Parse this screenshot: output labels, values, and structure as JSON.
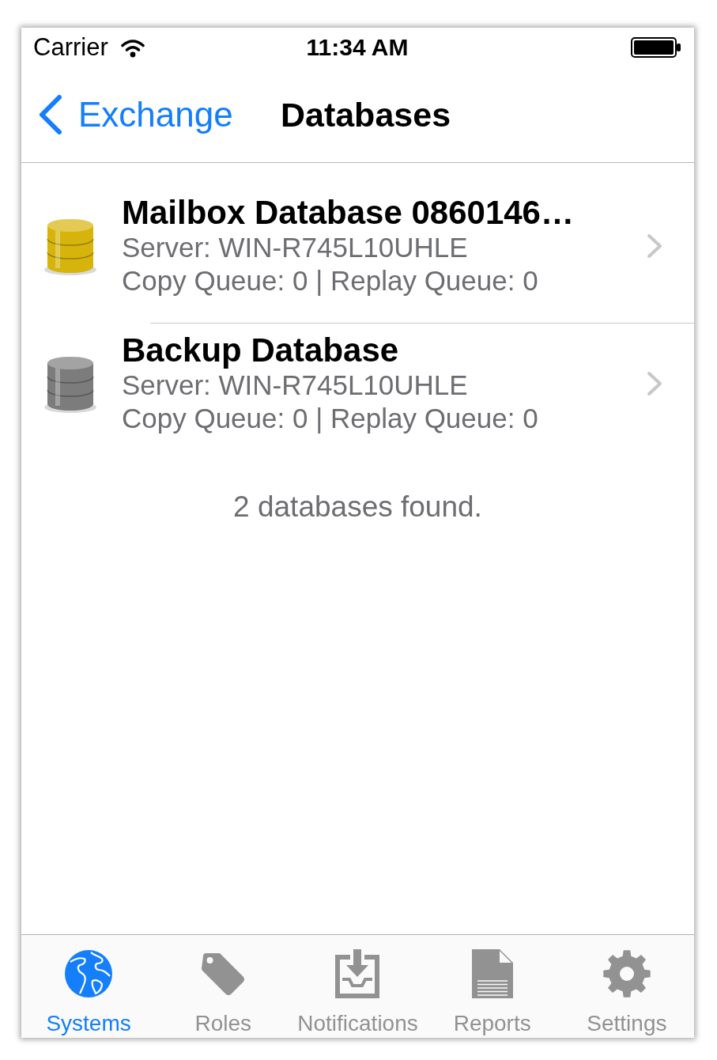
{
  "status_bar": {
    "carrier": "Carrier",
    "time": "11:34 AM"
  },
  "nav_bar": {
    "back": "Exchange",
    "title": "Databases"
  },
  "databases": [
    {
      "name": "Mailbox Database 0860146…",
      "server": "Server: WIN-R745L10UHLE",
      "queues": "Copy Queue: 0 | Replay Queue: 0",
      "color": "#d6b40c"
    },
    {
      "name": "Backup Database",
      "server": "Server: WIN-R745L10UHLE",
      "queues": "Copy Queue: 0 | Replay Queue: 0",
      "color": "#7c7c7c"
    }
  ],
  "footer": "2 databases found.",
  "tab_bar": [
    {
      "label": "Systems",
      "selected": true,
      "kind": "globe"
    },
    {
      "label": "Roles",
      "selected": false,
      "kind": "tag"
    },
    {
      "label": "Notifications",
      "selected": false,
      "kind": "tray"
    },
    {
      "label": "Reports",
      "selected": false,
      "kind": "document"
    },
    {
      "label": "Settings",
      "selected": false,
      "kind": "gear"
    }
  ]
}
